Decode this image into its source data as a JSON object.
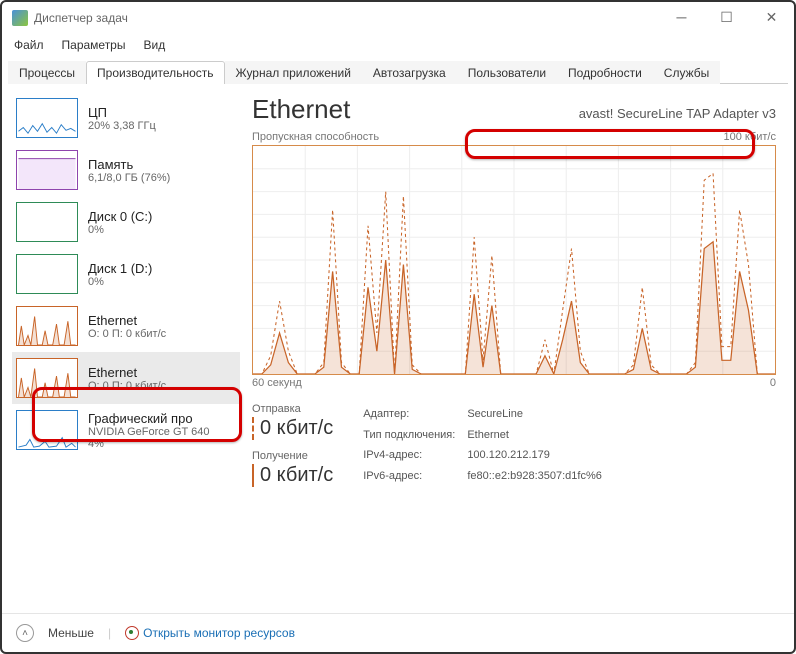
{
  "window": {
    "title": "Диспетчер задач"
  },
  "menu": {
    "file": "Файл",
    "options": "Параметры",
    "view": "Вид"
  },
  "tabs": {
    "processes": "Процессы",
    "performance": "Производительность",
    "apphistory": "Журнал приложений",
    "startup": "Автозагрузка",
    "users": "Пользователи",
    "details": "Подробности",
    "services": "Службы"
  },
  "sidebar": {
    "items": [
      {
        "name": "ЦП",
        "val": "20% 3,38 ГГц",
        "color": "#2b7ec8"
      },
      {
        "name": "Память",
        "val": "6,1/8,0 ГБ (76%)",
        "color": "#8e44ad"
      },
      {
        "name": "Диск 0 (C:)",
        "val": "0%",
        "color": "#2e8b57"
      },
      {
        "name": "Диск 1 (D:)",
        "val": "0%",
        "color": "#2e8b57"
      },
      {
        "name": "Ethernet",
        "val": "О: 0 П: 0 кбит/с",
        "color": "#c86428"
      },
      {
        "name": "Ethernet",
        "val": "О: 0 П: 0 кбит/с",
        "color": "#c86428"
      },
      {
        "name": "Графический про",
        "val": "NVIDIA GeForce GT 640",
        "val2": "4%",
        "color": "#2b7ec8"
      }
    ]
  },
  "main": {
    "title": "Ethernet",
    "adapter": "avast! SecureLine TAP Adapter v3",
    "chart_top_left": "Пропускная способность",
    "chart_top_right": "100 кбит/с",
    "chart_bottom_left": "60 секунд",
    "chart_bottom_right": "0",
    "send_label": "Отправка",
    "send_rate": "0 кбит/с",
    "recv_label": "Получение",
    "recv_rate": "0 кбит/с",
    "props": {
      "adapter_k": "Адаптер:",
      "adapter_v": "SecureLine",
      "conn_k": "Тип подключения:",
      "conn_v": "Ethernet",
      "ipv4_k": "IPv4-адрес:",
      "ipv4_v": "100.120.212.179",
      "ipv6_k": "IPv6-адрес:",
      "ipv6_v": "fe80::e2:b928:3507:d1fc%6"
    }
  },
  "footer": {
    "less": "Меньше",
    "monitor": "Открыть монитор ресурсов"
  },
  "chart_data": {
    "type": "line",
    "xlabel": "",
    "ylabel": "",
    "title": "",
    "x_range_seconds": 60,
    "ylim": [
      0,
      100
    ],
    "unit": "кбит/с",
    "series": [
      {
        "name": "Отправка",
        "style": "dashed",
        "values": [
          0,
          0,
          8,
          32,
          10,
          0,
          0,
          0,
          5,
          72,
          5,
          0,
          0,
          65,
          18,
          80,
          0,
          78,
          4,
          0,
          0,
          0,
          0,
          0,
          0,
          60,
          6,
          52,
          0,
          0,
          0,
          0,
          0,
          15,
          0,
          28,
          55,
          10,
          0,
          0,
          0,
          0,
          0,
          4,
          38,
          4,
          0,
          0,
          0,
          0,
          5,
          85,
          88,
          12,
          12,
          72,
          48,
          0,
          0,
          0
        ]
      },
      {
        "name": "Получение",
        "style": "solid",
        "values": [
          0,
          0,
          4,
          18,
          5,
          0,
          0,
          0,
          3,
          45,
          3,
          0,
          0,
          38,
          10,
          50,
          0,
          48,
          2,
          0,
          0,
          0,
          0,
          0,
          0,
          35,
          3,
          30,
          0,
          0,
          0,
          0,
          0,
          8,
          0,
          15,
          32,
          5,
          0,
          0,
          0,
          0,
          0,
          2,
          20,
          2,
          0,
          0,
          0,
          0,
          3,
          55,
          58,
          6,
          6,
          45,
          28,
          0,
          0,
          0
        ]
      }
    ]
  }
}
